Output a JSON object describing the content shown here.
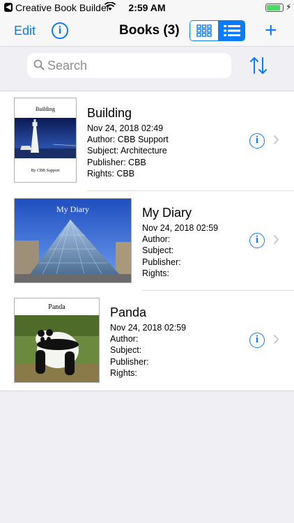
{
  "status_bar": {
    "back_glyph": "◀",
    "carrier": "Creative Book Builder",
    "time": "2:59 AM",
    "battery_level": 0.88
  },
  "nav": {
    "edit_label": "Edit",
    "info_glyph": "i",
    "title": "Books (3)",
    "add_glyph": "+",
    "selected_view": "list"
  },
  "search": {
    "placeholder": "Search",
    "value": ""
  },
  "books": [
    {
      "title": "Building",
      "date": "Nov 24, 2018 02:49",
      "author": "Author: CBB Support",
      "subject": "Subject: Architecture",
      "publisher": "Publisher: CBB",
      "rights": "Rights: CBB",
      "cover_title": "Building",
      "cover_byline": "By CBB Support"
    },
    {
      "title": "My Diary",
      "date": "Nov 24, 2018 02:59",
      "author": "Author:",
      "subject": "Subject:",
      "publisher": "Publisher:",
      "rights": "Rights:",
      "cover_title": "My Diary"
    },
    {
      "title": "Panda",
      "date": "Nov 24, 2018 02:59",
      "author": "Author:",
      "subject": "Subject:",
      "publisher": "Publisher:",
      "rights": "Rights:",
      "cover_title": "Panda"
    }
  ],
  "colors": {
    "accent": "#0a7aff",
    "background": "#efeff4"
  }
}
